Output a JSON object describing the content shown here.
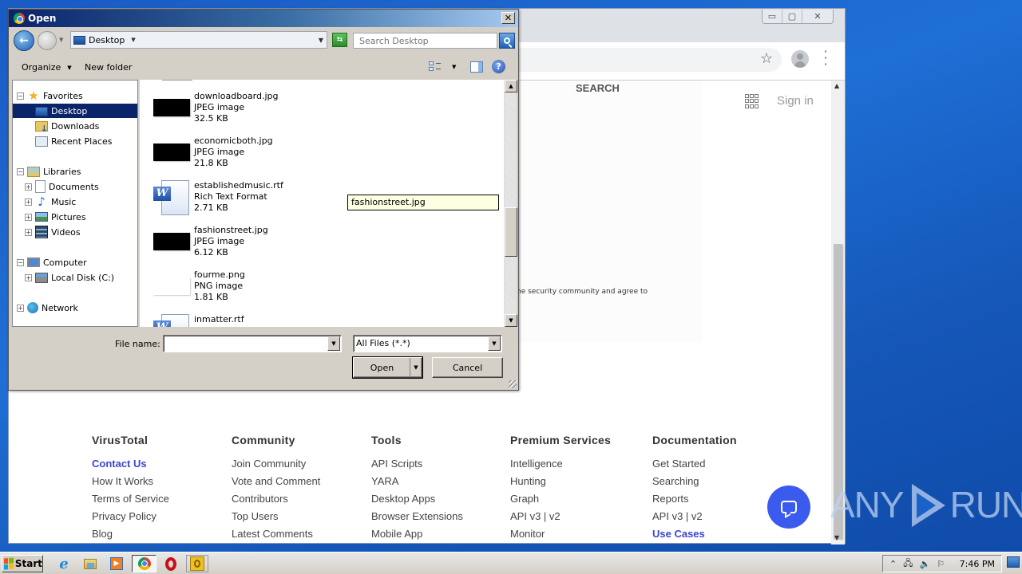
{
  "browser": {
    "window_controls": {
      "minimize": "▭",
      "maximize": "▢",
      "close": "✕"
    },
    "page": {
      "search_label": "SEARCH",
      "signin_label": "Sign in",
      "partial_text": "he security community and agree to"
    },
    "footer": {
      "columns": [
        {
          "title": "VirusTotal",
          "links": [
            "Contact Us",
            "How It Works",
            "Terms of Service",
            "Privacy Policy",
            "Blog"
          ],
          "accent_index": 0
        },
        {
          "title": "Community",
          "links": [
            "Join Community",
            "Vote and Comment",
            "Contributors",
            "Top Users",
            "Latest Comments"
          ]
        },
        {
          "title": "Tools",
          "links": [
            "API Scripts",
            "YARA",
            "Desktop Apps",
            "Browser Extensions",
            "Mobile App"
          ]
        },
        {
          "title": "Premium Services",
          "links": [
            "Intelligence",
            "Hunting",
            "Graph",
            "API v3 | v2",
            "Monitor"
          ]
        },
        {
          "title": "Documentation",
          "links": [
            "Get Started",
            "Searching",
            "Reports",
            "API v3 | v2",
            "Use Cases"
          ],
          "accent_index": 4
        }
      ]
    },
    "accent_color": "#3b46d1",
    "chat_button_color": "#3b5bef"
  },
  "dialog": {
    "title": "Open",
    "close_glyph": "✕",
    "address": {
      "location": "Desktop"
    },
    "search": {
      "placeholder": "Search Desktop"
    },
    "commands": {
      "organize": "Organize",
      "new_folder": "New folder",
      "help": "?"
    },
    "nav_tree": [
      {
        "label": "Favorites",
        "icon": "star-icon",
        "level": 0,
        "expander": "−"
      },
      {
        "label": "Desktop",
        "icon": "desktop-icon",
        "level": 1,
        "selected": true
      },
      {
        "label": "Downloads",
        "icon": "downloads-icon",
        "level": 1
      },
      {
        "label": "Recent Places",
        "icon": "recent-places-icon",
        "level": 1
      },
      {
        "label": "Libraries",
        "icon": "libraries-icon",
        "level": 0,
        "expander": "−"
      },
      {
        "label": "Documents",
        "icon": "documents-icon",
        "level": 1,
        "expander": "+"
      },
      {
        "label": "Music",
        "icon": "music-icon",
        "level": 1,
        "expander": "+"
      },
      {
        "label": "Pictures",
        "icon": "pictures-icon",
        "level": 1,
        "expander": "+"
      },
      {
        "label": "Videos",
        "icon": "videos-icon",
        "level": 1,
        "expander": "+"
      },
      {
        "label": "Computer",
        "icon": "computer-icon",
        "level": 0,
        "expander": "−"
      },
      {
        "label": "Local Disk (C:)",
        "icon": "disk-icon",
        "level": 1,
        "expander": "+"
      },
      {
        "label": "Network",
        "icon": "network-icon",
        "level": 0,
        "expander": "+"
      }
    ],
    "files": [
      {
        "name": "downloadboard.jpg",
        "type": "JPEG image",
        "size": "32.5 KB",
        "kind": "jpg"
      },
      {
        "name": "economicboth.jpg",
        "type": "JPEG image",
        "size": "21.8 KB",
        "kind": "jpg"
      },
      {
        "name": "establishedmusic.rtf",
        "type": "Rich Text Format",
        "size": "2.71 KB",
        "kind": "rtf"
      },
      {
        "name": "fashionstreet.jpg",
        "type": "JPEG image",
        "size": "6.12 KB",
        "kind": "jpg"
      },
      {
        "name": "fourme.png",
        "type": "PNG image",
        "size": "1.81 KB",
        "kind": "png"
      },
      {
        "name": "inmatter.rtf",
        "type": "",
        "size": "",
        "kind": "rtf"
      }
    ],
    "tooltip": "fashionstreet.jpg",
    "file_name_label": "File name:",
    "file_name_value": "",
    "file_type_filter": "All Files (*.*)",
    "open_button": "Open",
    "cancel_button": "Cancel"
  },
  "taskbar": {
    "start_label": "Start",
    "apps": [
      "internet-explorer",
      "windows-explorer",
      "media-player",
      "chrome",
      "opera",
      "norton"
    ],
    "active_app": "chrome",
    "clock": "7:46 PM"
  },
  "watermark": {
    "left": "ANY",
    "right": "RUN"
  }
}
